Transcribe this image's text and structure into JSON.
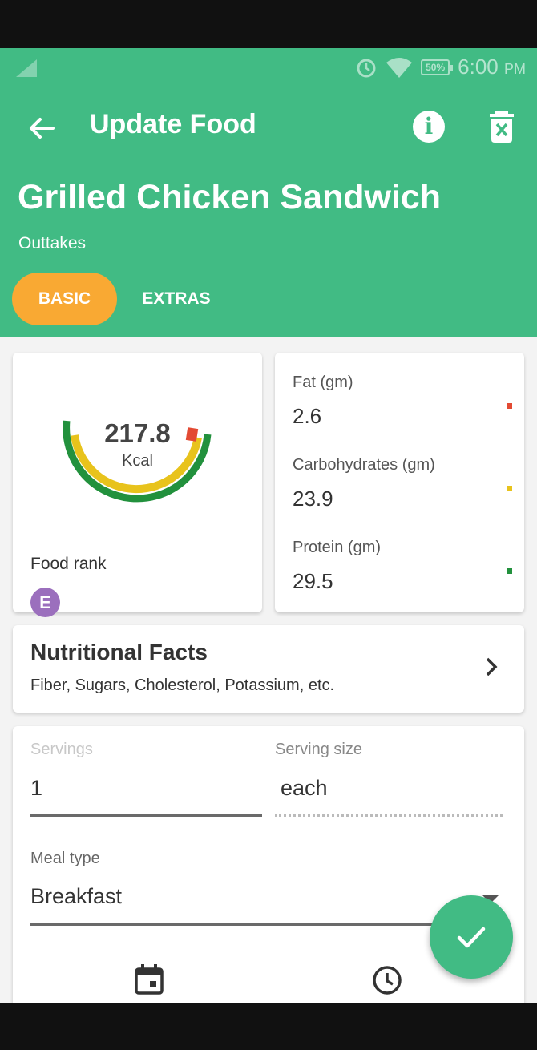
{
  "status_bar": {
    "battery": "50%",
    "time": "6:00",
    "ampm": "PM"
  },
  "appbar": {
    "title": "Update Food"
  },
  "food": {
    "name": "Grilled Chicken Sandwich",
    "brand": "Outtakes"
  },
  "tabs": [
    {
      "label": "BASIC"
    },
    {
      "label": "EXTRAS"
    }
  ],
  "calories": {
    "value": "217.8",
    "unit": "Kcal"
  },
  "food_rank": {
    "label": "Food rank",
    "grade": "E"
  },
  "macros": [
    {
      "label": "Fat (gm)",
      "value": "2.6",
      "color": "#e34a33"
    },
    {
      "label": "Carbohydrates (gm)",
      "value": "23.9",
      "color": "#e8c31c"
    },
    {
      "label": "Protein (gm)",
      "value": "29.5",
      "color": "#22913d"
    }
  ],
  "nutritional_facts": {
    "title": "Nutritional Facts",
    "subtitle": "Fiber, Sugars, Cholesterol, Potassium, etc."
  },
  "form": {
    "servings_label": "Servings",
    "servings_value": "1",
    "serving_size_label": "Serving size",
    "serving_size_value": "each",
    "meal_type_label": "Meal type",
    "meal_type_value": "Breakfast"
  },
  "colors": {
    "primary": "#41bb84",
    "accent": "#f9a933",
    "rank": "#9b6fbd"
  },
  "icons": [
    "back-arrow-icon",
    "info-icon",
    "delete-icon",
    "chevron-right-icon",
    "calendar-icon",
    "clock-icon",
    "check-icon"
  ]
}
